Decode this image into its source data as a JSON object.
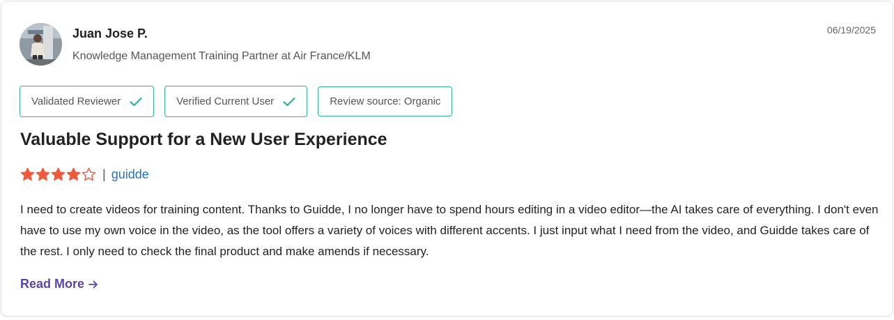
{
  "reviewer": {
    "name": "Juan Jose P.",
    "title": "Knowledge Management Training Partner at Air France/KLM",
    "avatar_icon": "user-photo"
  },
  "review": {
    "date": "06/19/2025",
    "title": "Valuable Support for a New User Experience",
    "rating": 4,
    "rating_max": 5,
    "separator": "|",
    "product": "guidde",
    "body": "I need to create videos for training content. Thanks to Guidde, I no longer have to spend hours editing in a video editor—the AI takes care of everything. I don't even have to use my own voice in the video, as the tool offers a variety of voices with different accents. I just input what I need from the video, and Guidde takes care of the rest. I only need to check the final product and make amends if necessary.",
    "read_more_label": "Read More"
  },
  "badges": [
    {
      "label": "Validated Reviewer",
      "icon": "check-icon"
    },
    {
      "label": "Verified Current User",
      "icon": "check-icon"
    },
    {
      "label": "Review source: Organic"
    }
  ],
  "colors": {
    "badge_border": "#2bb59a",
    "check": "#2bb59a",
    "star": "#f05a3a",
    "link": "#1a73c8",
    "read_more": "#5b46a8"
  }
}
